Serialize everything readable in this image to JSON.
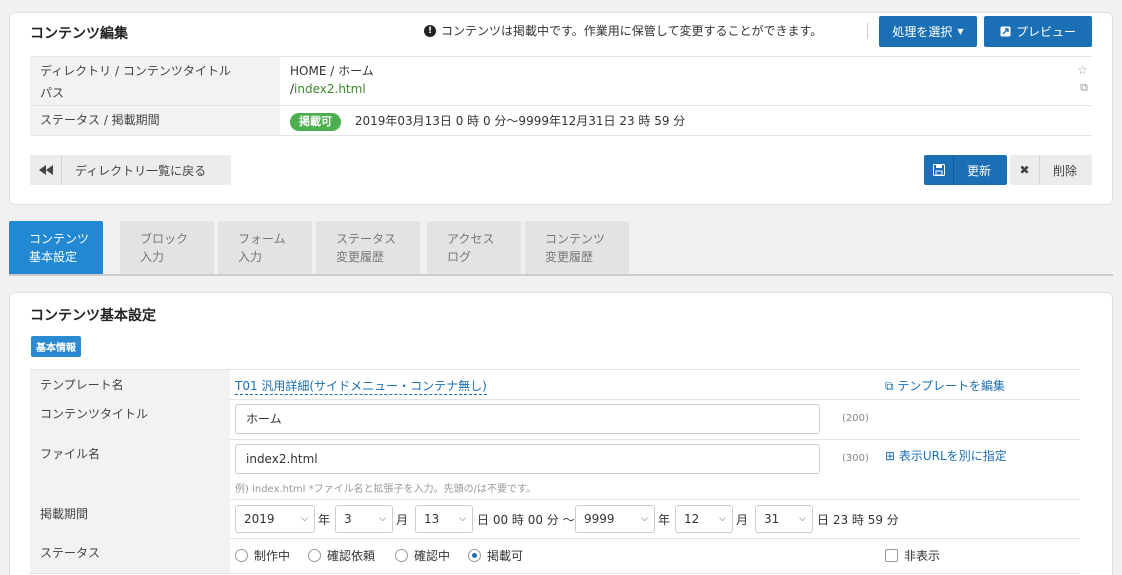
{
  "header": {
    "title": "コンテンツ編集",
    "notice": "コンテンツは掲載中です。作業用に保管して変更することができます。",
    "select_action_label": "処理を選択",
    "preview_label": "プレビュー"
  },
  "info_rows": {
    "path_label_1": "ディレクトリ / コンテンツタイトル",
    "path_label_2": "パス",
    "path_value_1": "HOME / ホーム",
    "path_value_2_prefix": "/",
    "path_value_2_link": "index2.html",
    "status_label": "ステータス / 掲載期間",
    "status_badge": "掲載可",
    "status_period": "2019年03月13日 0 時  0 分〜9999年12月31日 23 時  59 分"
  },
  "actions": {
    "back_label": "ディレクトリ一覧に戻る",
    "update_label": "更新",
    "delete_label": "削除"
  },
  "tabs": [
    {
      "line1": "コンテンツ",
      "line2": "基本設定"
    },
    {
      "line1": "ブロック",
      "line2": "入力"
    },
    {
      "line1": "フォーム",
      "line2": "入力"
    },
    {
      "line1": "ステータス",
      "line2": "変更履歴"
    },
    {
      "line1": "アクセス",
      "line2": "ログ"
    },
    {
      "line1": "コンテンツ",
      "line2": "変更履歴"
    }
  ],
  "main": {
    "title": "コンテンツ基本設定",
    "section_badge": "基本情報",
    "template": {
      "label": "テンプレート名",
      "value": "T01 汎用詳細(サイドメニュー・コンテナ無し)",
      "edit_link": "テンプレートを編集"
    },
    "content_title": {
      "label": "コンテンツタイトル",
      "value": "ホーム",
      "count": "(200)"
    },
    "file_name": {
      "label": "ファイル名",
      "value": "index2.html",
      "count": "(300)",
      "hint": "例) index.html *ファイル名と拡張子を入力。先頭の/は不要です。",
      "url_link": "表示URLを別に指定"
    },
    "period": {
      "label": "掲載期間",
      "start_year": "2019",
      "year_unit": "年",
      "start_month": "3",
      "month_unit": "月",
      "start_day": "13",
      "start_time": "日 00 時 00 分 〜",
      "end_year": "9999",
      "end_month": "12",
      "end_day": "31",
      "end_time": "日 23 時 59 分"
    },
    "status": {
      "label": "ステータス",
      "options": [
        "制作中",
        "確認依頼",
        "確認中",
        "掲載可"
      ],
      "selected": "掲載可",
      "hidden_label": "非表示"
    }
  }
}
